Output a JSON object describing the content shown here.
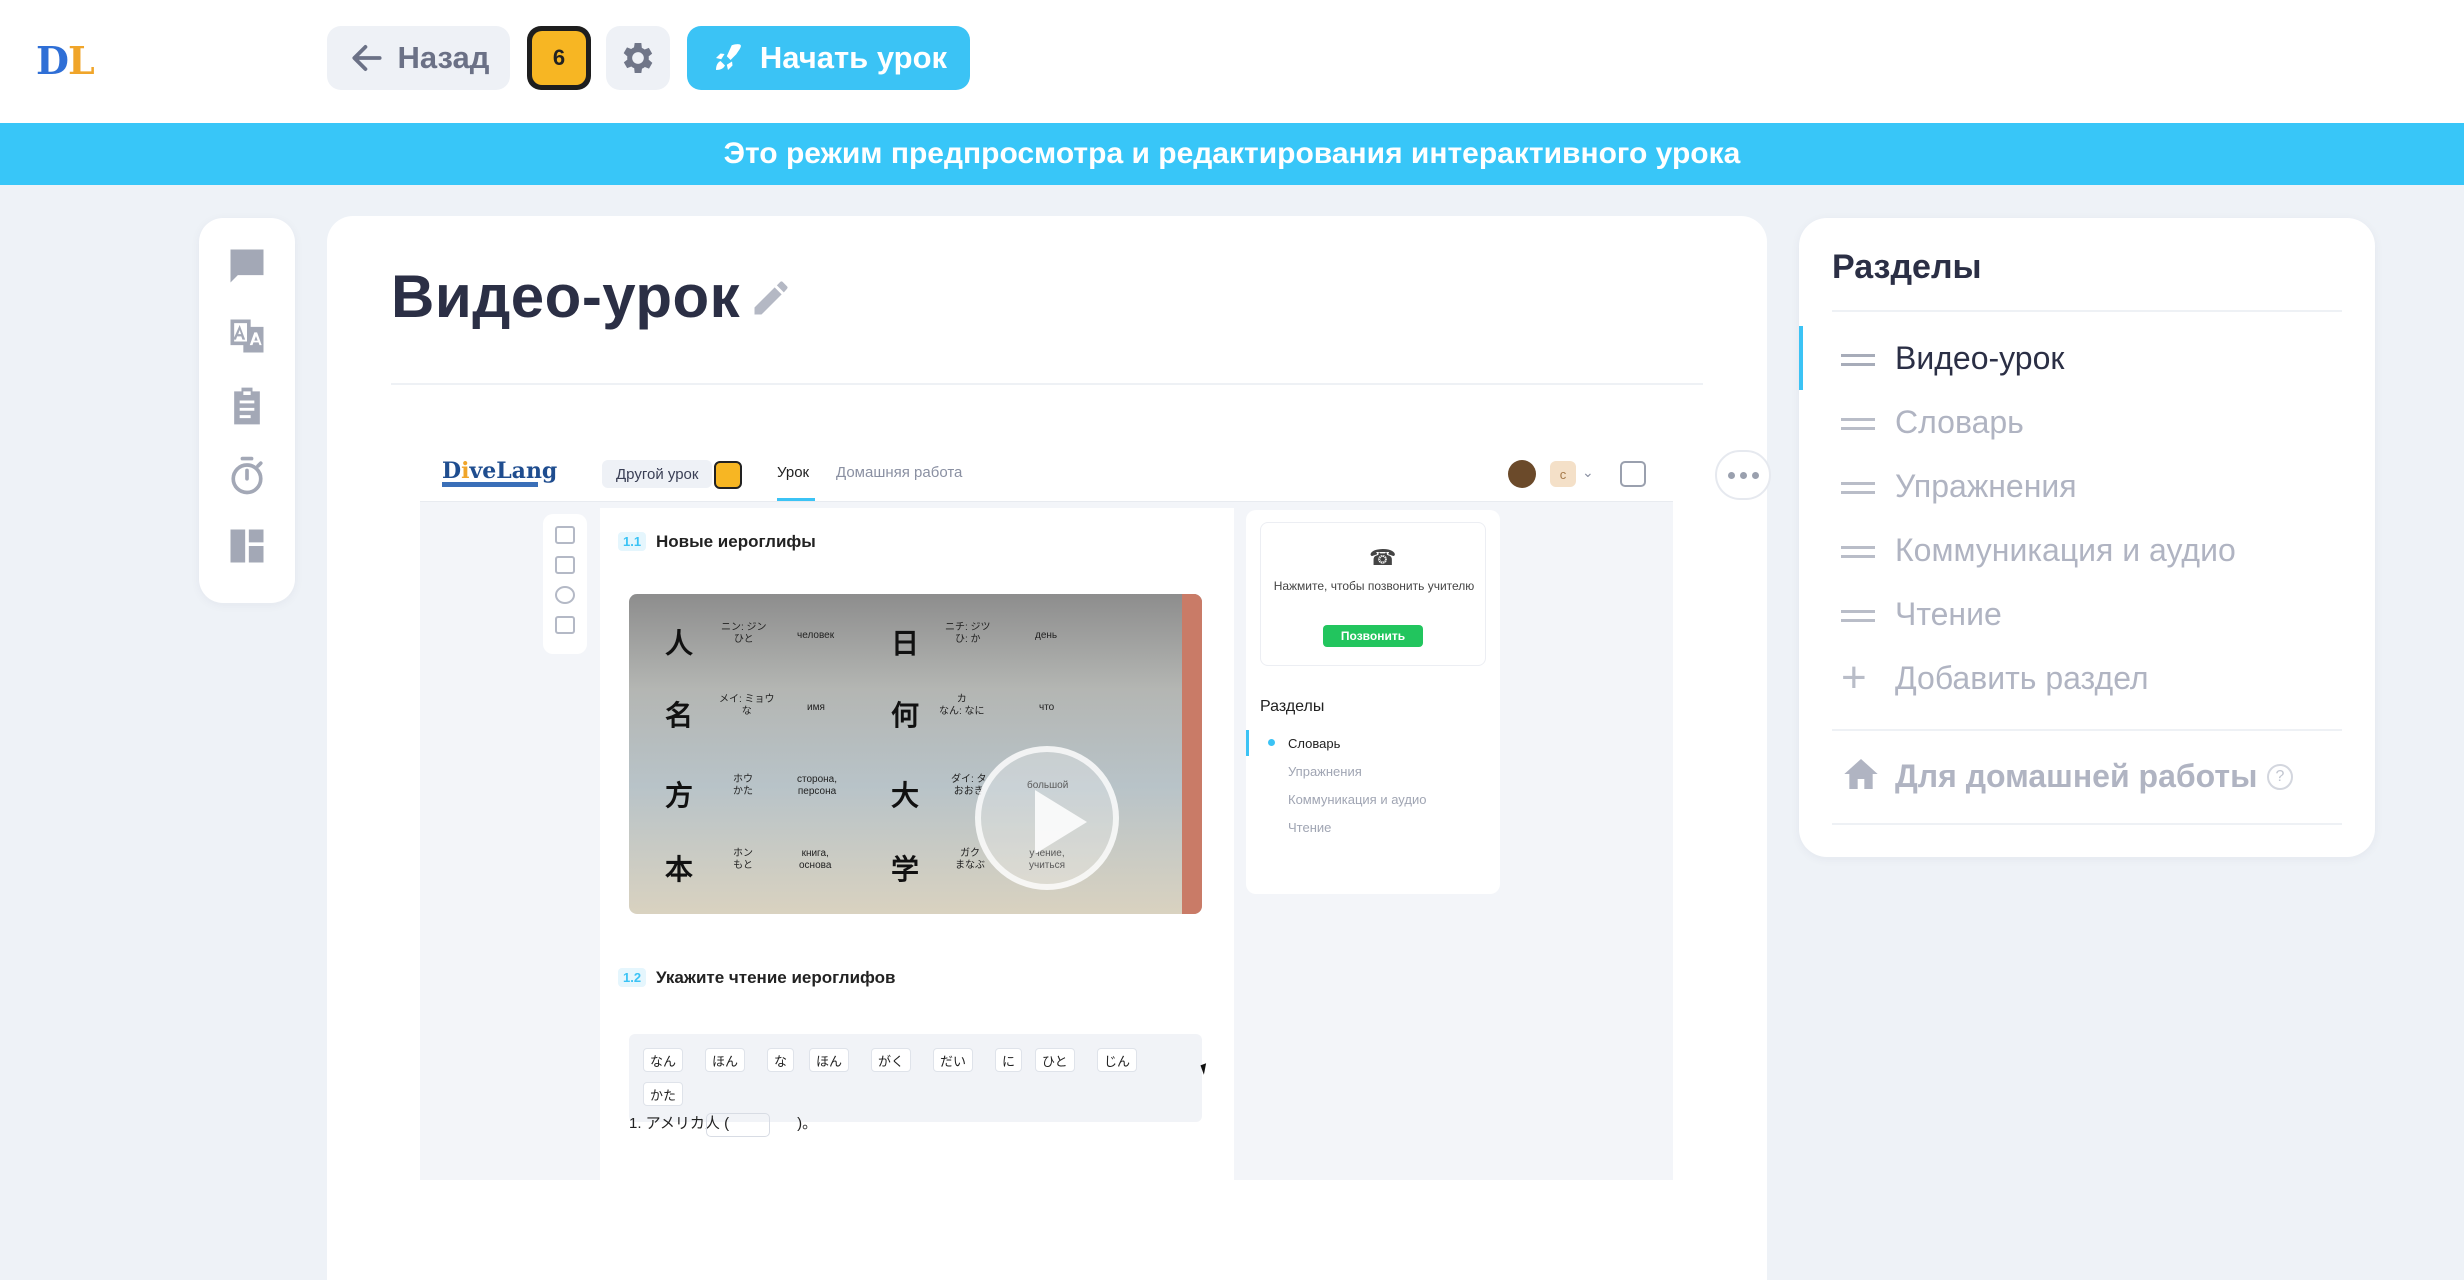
{
  "header": {
    "logo": {
      "d": "D",
      "l": "L"
    },
    "back_label": "Назад",
    "avatar_label": "6",
    "start_label": "Начать урок",
    "accent": "#3bc3f5"
  },
  "banner": {
    "text": "Это режим предпросмотра и редактирования интерактивного урока"
  },
  "rail_icons": [
    "chat-icon",
    "translate-icon",
    "clipboard-icon",
    "timer-icon",
    "layout-icon"
  ],
  "main": {
    "title": "Видео-урок"
  },
  "video": {
    "logo": {
      "pre": "D",
      "o": "i",
      "post": "veLang"
    },
    "other_lesson": "Другой урок",
    "tab_lesson": "Урок",
    "tab_homework": "Домашняя работа",
    "user_initial": "с",
    "task1_num": "1.1",
    "task1_title": "Новые иероглифы",
    "kanji": [
      {
        "k": "人",
        "r": "ニン: ジン\nひと",
        "m": "человек"
      },
      {
        "k": "日",
        "r": "ニチ: ジツ\nひ: か",
        "m": "день"
      },
      {
        "k": "名",
        "r": "メイ: ミョウ\nな",
        "m": "имя"
      },
      {
        "k": "何",
        "r": "カ\nなん: なに",
        "m": "что"
      },
      {
        "k": "方",
        "r": "ホウ\nかた",
        "m": "сторона,\nперсона"
      },
      {
        "k": "大",
        "r": "ダイ: タ\nおおき",
        "m": "большой"
      },
      {
        "k": "本",
        "r": "ホン\nもと",
        "m": "книга,\nоснова"
      },
      {
        "k": "学",
        "r": "ガク\nまなぶ",
        "m": "учение,\nучиться"
      }
    ],
    "task2_num": "1.2",
    "task2_title": "Укажите чтение иероглифов",
    "chips": [
      "なん",
      "ほん",
      "な",
      "ほん",
      "がく",
      "だい",
      "に",
      "ひと",
      "じん",
      "かた"
    ],
    "sentence_pre": "1. アメリカ人 (",
    "sentence_post": ")。",
    "call_text": "Нажмите, чтобы позвонить учителю",
    "call_button": "Позвонить",
    "sections_title": "Разделы",
    "sections": [
      "Словарь",
      "Упражнения",
      "Коммуникация и аудио",
      "Чтение"
    ]
  },
  "sections_panel": {
    "title": "Разделы",
    "items": [
      "Видео-урок",
      "Словарь",
      "Упражнения",
      "Коммуникация и аудио",
      "Чтение"
    ],
    "active_index": 0,
    "add_label": "Добавить раздел",
    "homework_label": "Для домашней работы",
    "help": "?"
  }
}
